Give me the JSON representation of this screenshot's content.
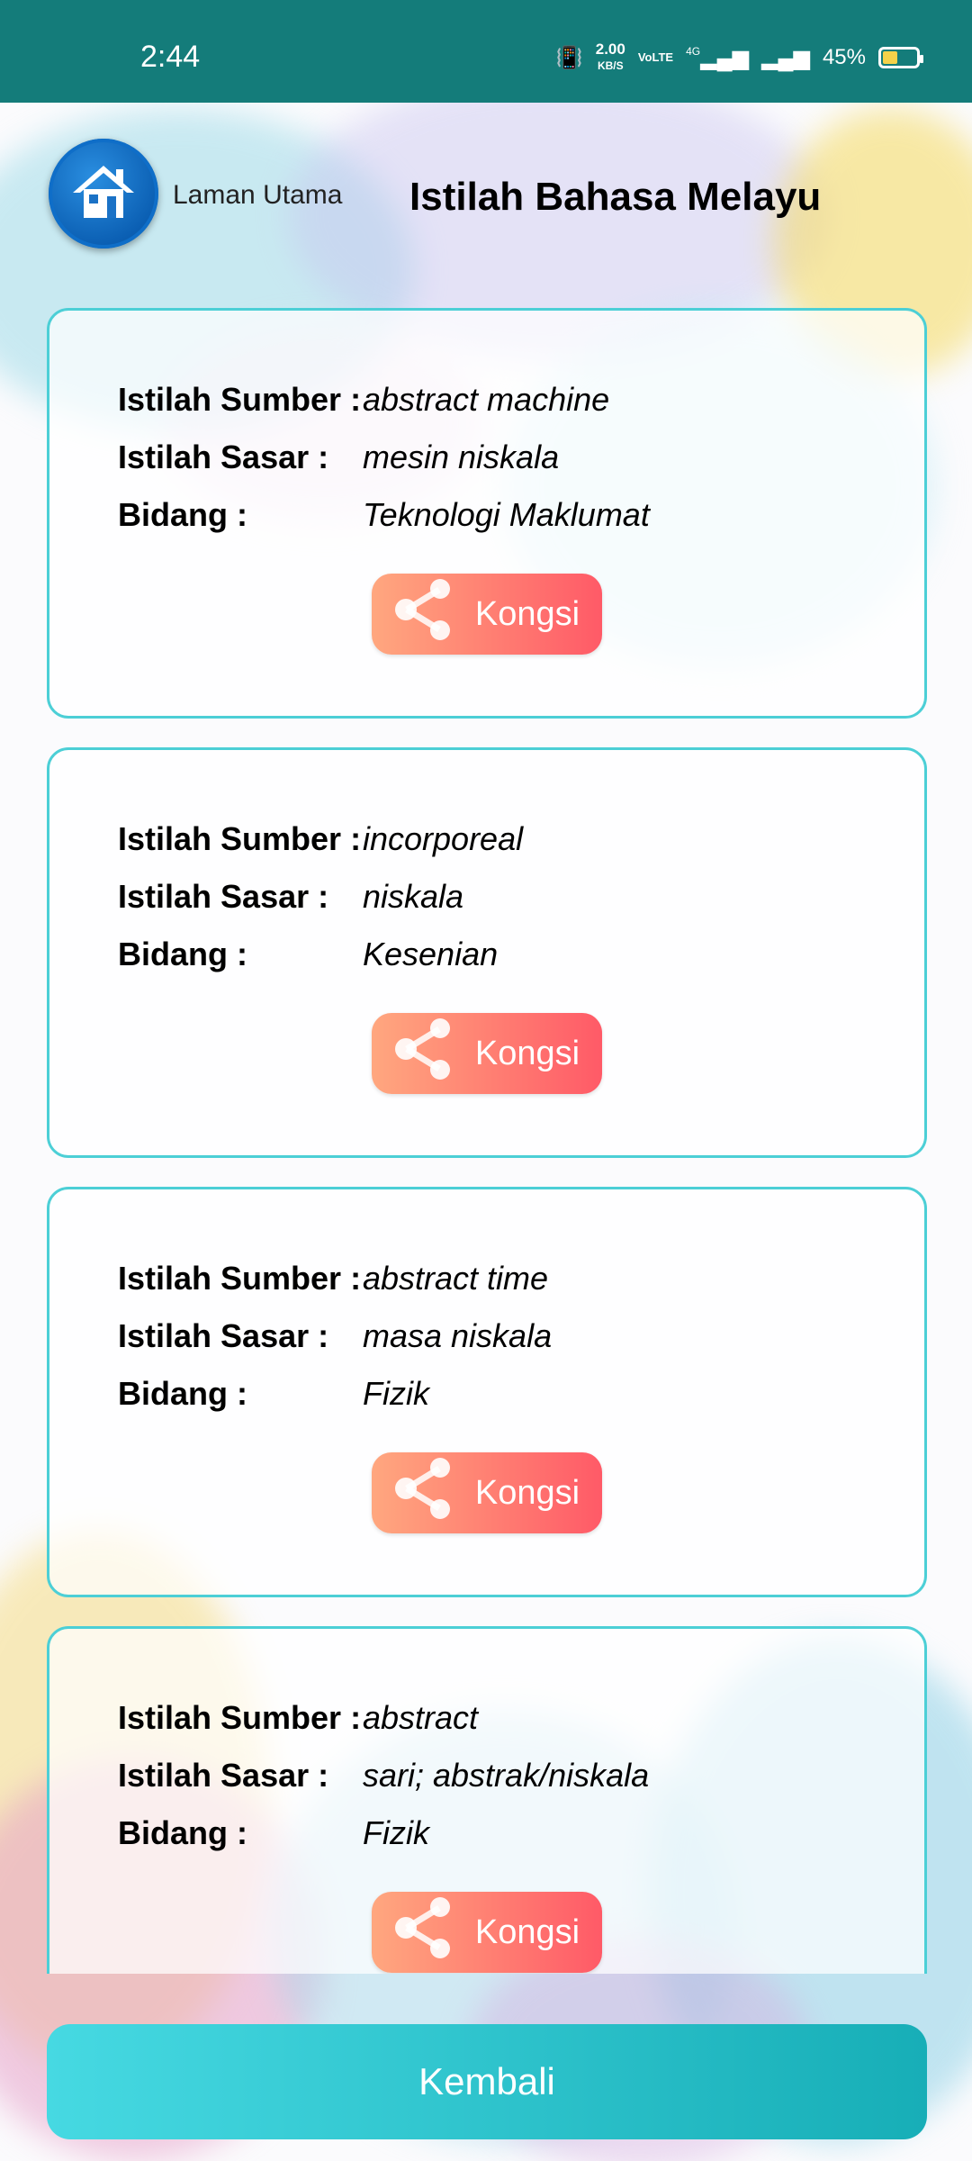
{
  "status_bar": {
    "time": "2:44",
    "net_speed": "2.00",
    "net_unit": "KB/S",
    "volte": "VoLTE",
    "network": "4G",
    "battery": "45%",
    "battery_level": 0.45
  },
  "header": {
    "home_label": "Laman Utama",
    "title": "Istilah Bahasa Melayu"
  },
  "labels": {
    "source": "Istilah Sumber :",
    "target": "Istilah Sasar :",
    "field": "Bidang :"
  },
  "entries": [
    {
      "source": "abstract machine",
      "target": "mesin niskala",
      "field": "Teknologi Maklumat",
      "share_label": "Kongsi"
    },
    {
      "source": "incorporeal",
      "target": "niskala",
      "field": "Kesenian",
      "share_label": "Kongsi"
    },
    {
      "source": "abstract time",
      "target": "masa niskala",
      "field": "Fizik",
      "share_label": "Kongsi"
    },
    {
      "source": "abstract",
      "target": "sari; abstrak/niskala",
      "field": "Fizik",
      "share_label": "Kongsi"
    }
  ],
  "footer": {
    "back_label": "Kembali"
  },
  "colors": {
    "status_bar": "#147c7a",
    "card_border": "#4ccfd6",
    "share_gradient": [
      "#ffa77f",
      "#ff5a67"
    ],
    "back_gradient": [
      "#46d9e2",
      "#17aeb7"
    ]
  },
  "icons": {
    "home": "home-icon",
    "share": "share-icon"
  }
}
